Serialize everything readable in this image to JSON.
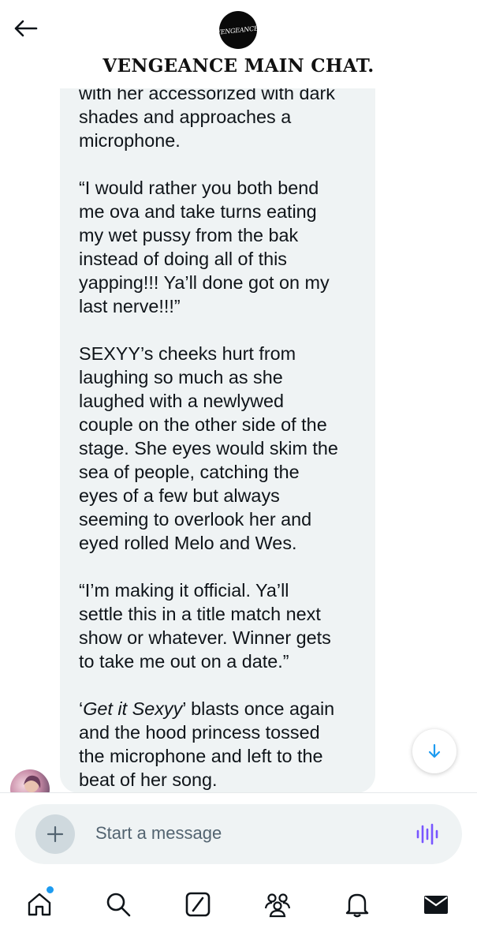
{
  "header": {
    "group_title": "VENGEANCE MAIN CHAT.",
    "avatar_text": "VENGEANCE!"
  },
  "message": {
    "paragraphs": [
      {
        "lines": [
          "with her accessorized with dark",
          "shades and approaches a",
          "microphone."
        ]
      },
      {
        "lines": [
          "“I would rather you both bend",
          "me ova and take turns eating",
          "my wet pussy from the bak",
          "instead of doing all of this",
          "yapping!!! Ya’ll done got on my",
          "last nerve!!!”"
        ]
      },
      {
        "lines": [
          "SEXYY’s cheeks hurt from",
          "laughing so much as she",
          "laughed with a newlywed",
          "couple on the other side of the",
          "stage. She eyes would skim the",
          "sea of people, catching the",
          "eyes of a few but always",
          "seeming to overlook her and",
          "eyed rolled Melo and Wes."
        ]
      },
      {
        "lines": [
          "“I’m making it official. Ya’ll",
          "settle this in a title match next",
          "show or whatever. Winner gets",
          "to take me out on a date.”"
        ]
      }
    ],
    "last_paragraph": {
      "quote_open": "‘",
      "song_title": "Get it Sexyy",
      "quote_close": "’",
      "line1_rest": " blasts once again",
      "lines": [
        "and the hood princess tossed",
        "the microphone and left to the",
        "beat of her song."
      ]
    }
  },
  "composer": {
    "placeholder": "Start a message"
  },
  "colors": {
    "bubble_bg": "#eff3f4",
    "accent_blue": "#1d9bf0",
    "voice_purple": "#7856ff",
    "text": "#0f1419",
    "muted": "#536471"
  },
  "icons": {
    "back": "arrow-left-icon",
    "scroll": "arrow-down-icon",
    "plus": "plus-icon",
    "voice": "voice-wave-icon",
    "tabs": [
      "home-icon",
      "search-icon",
      "grok-icon",
      "communities-icon",
      "notifications-icon",
      "messages-icon"
    ]
  }
}
